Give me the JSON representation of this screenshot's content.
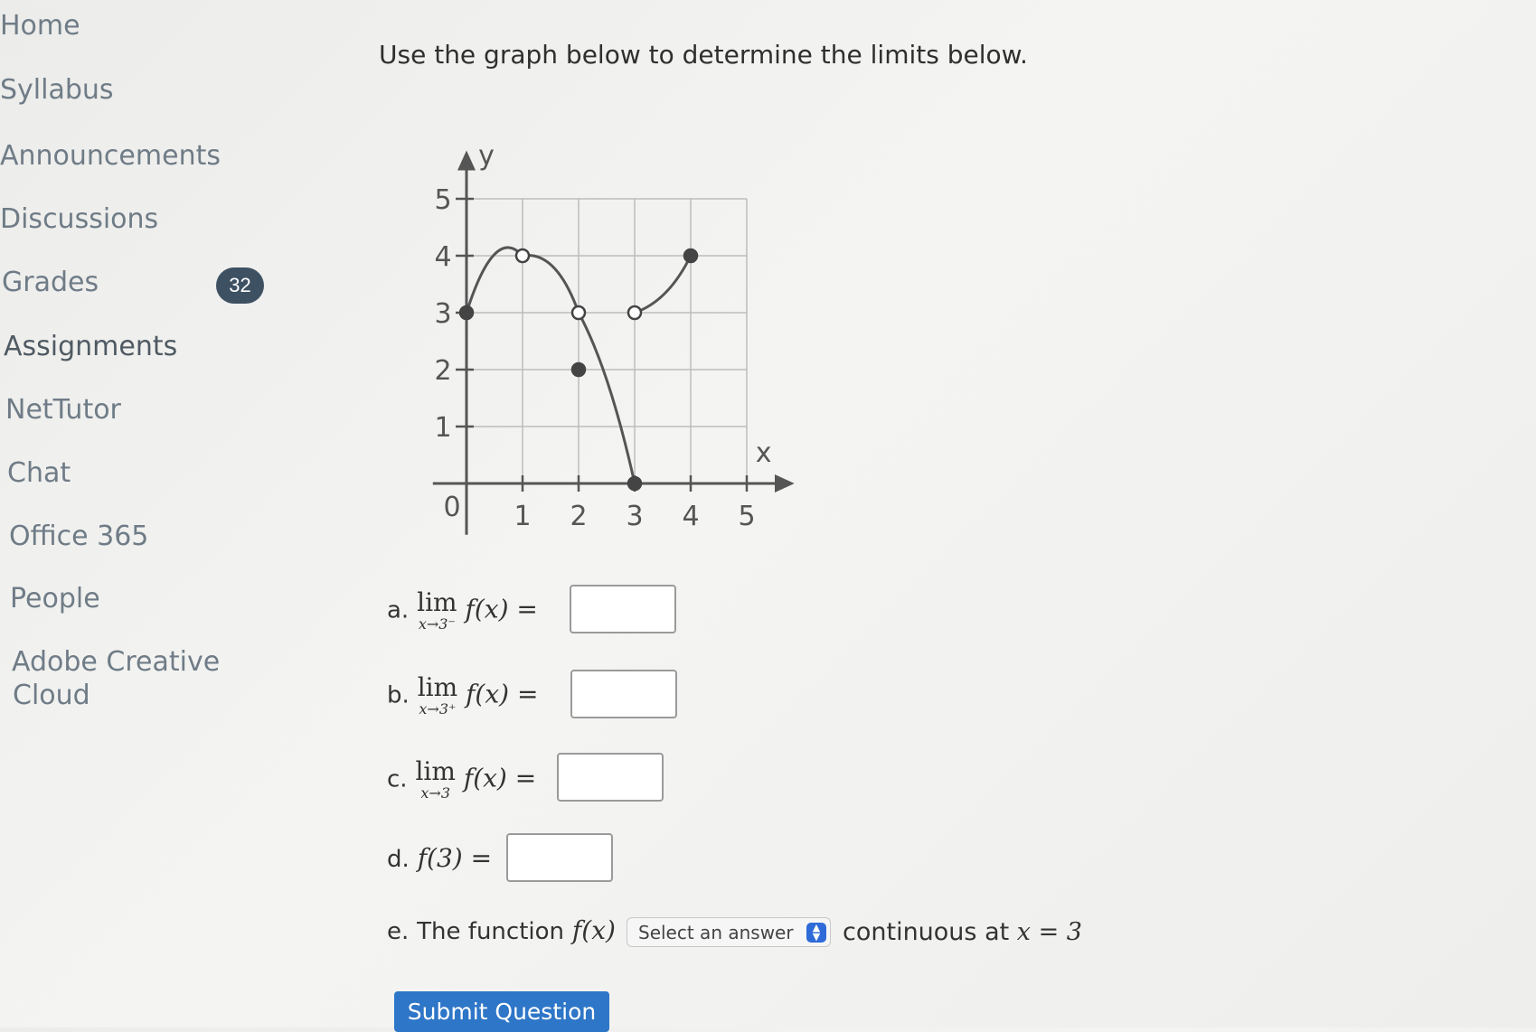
{
  "sidebar": {
    "items": [
      {
        "label": "Home",
        "y": 12
      },
      {
        "label": "Syllabus",
        "y": 83
      },
      {
        "label": "Announcements",
        "y": 156
      },
      {
        "label": "Discussions",
        "y": 226
      },
      {
        "label": "Grades",
        "y": 296
      },
      {
        "label": "Assignments",
        "y": 367
      },
      {
        "label": "NetTutor",
        "y": 437
      },
      {
        "label": "Chat",
        "y": 507
      },
      {
        "label": "Office 365",
        "y": 577
      },
      {
        "label": "People",
        "y": 646
      },
      {
        "label": "Adobe Creative",
        "y": 716
      },
      {
        "label": "Cloud",
        "y": 753
      }
    ],
    "grades_badge": "32"
  },
  "main": {
    "prompt": "Use the graph below to determine the limits below.",
    "graph": {
      "x_axis_label": "x",
      "y_axis_label": "y",
      "x_ticks": [
        "1",
        "2",
        "3",
        "4",
        "5"
      ],
      "y_ticks": [
        "1",
        "2",
        "3",
        "4",
        "5"
      ],
      "origin_label": "0"
    },
    "questions": {
      "a": {
        "letter": "a.",
        "lim": "lim",
        "sub": "x→3⁻",
        "expr": "f(x) ="
      },
      "b": {
        "letter": "b.",
        "lim": "lim",
        "sub": "x→3⁺",
        "expr": "f(x) ="
      },
      "c": {
        "letter": "c.",
        "lim": "lim",
        "sub": "x→3",
        "expr": "f(x) ="
      },
      "d": {
        "letter": "d.",
        "expr": "f(3) ="
      },
      "e": {
        "letter": "e.",
        "text": "The function",
        "fx": "f(x)",
        "select_placeholder": "Select an answer",
        "continuous_text": "continuous at",
        "at": "x = 3"
      }
    },
    "submit_label": "Submit Question"
  },
  "chart_data": {
    "type": "line",
    "xlabel": "x",
    "ylabel": "y",
    "xlim": [
      0,
      5
    ],
    "ylim": [
      0,
      5
    ],
    "grid": true,
    "segments": [
      {
        "from": [
          0,
          3
        ],
        "peak": [
          1,
          4
        ],
        "to": [
          2,
          3
        ]
      },
      {
        "from": [
          2,
          3
        ],
        "to": [
          3,
          0
        ]
      },
      {
        "from": [
          3,
          3
        ],
        "to": [
          4,
          4
        ]
      }
    ],
    "points": [
      {
        "x": 0,
        "y": 3,
        "filled": true
      },
      {
        "x": 1,
        "y": 4,
        "filled": false
      },
      {
        "x": 2,
        "y": 3,
        "filled": false
      },
      {
        "x": 2,
        "y": 2,
        "filled": true
      },
      {
        "x": 3,
        "y": 0,
        "filled": true
      },
      {
        "x": 3,
        "y": 3,
        "filled": false
      },
      {
        "x": 4,
        "y": 4,
        "filled": true
      }
    ]
  }
}
